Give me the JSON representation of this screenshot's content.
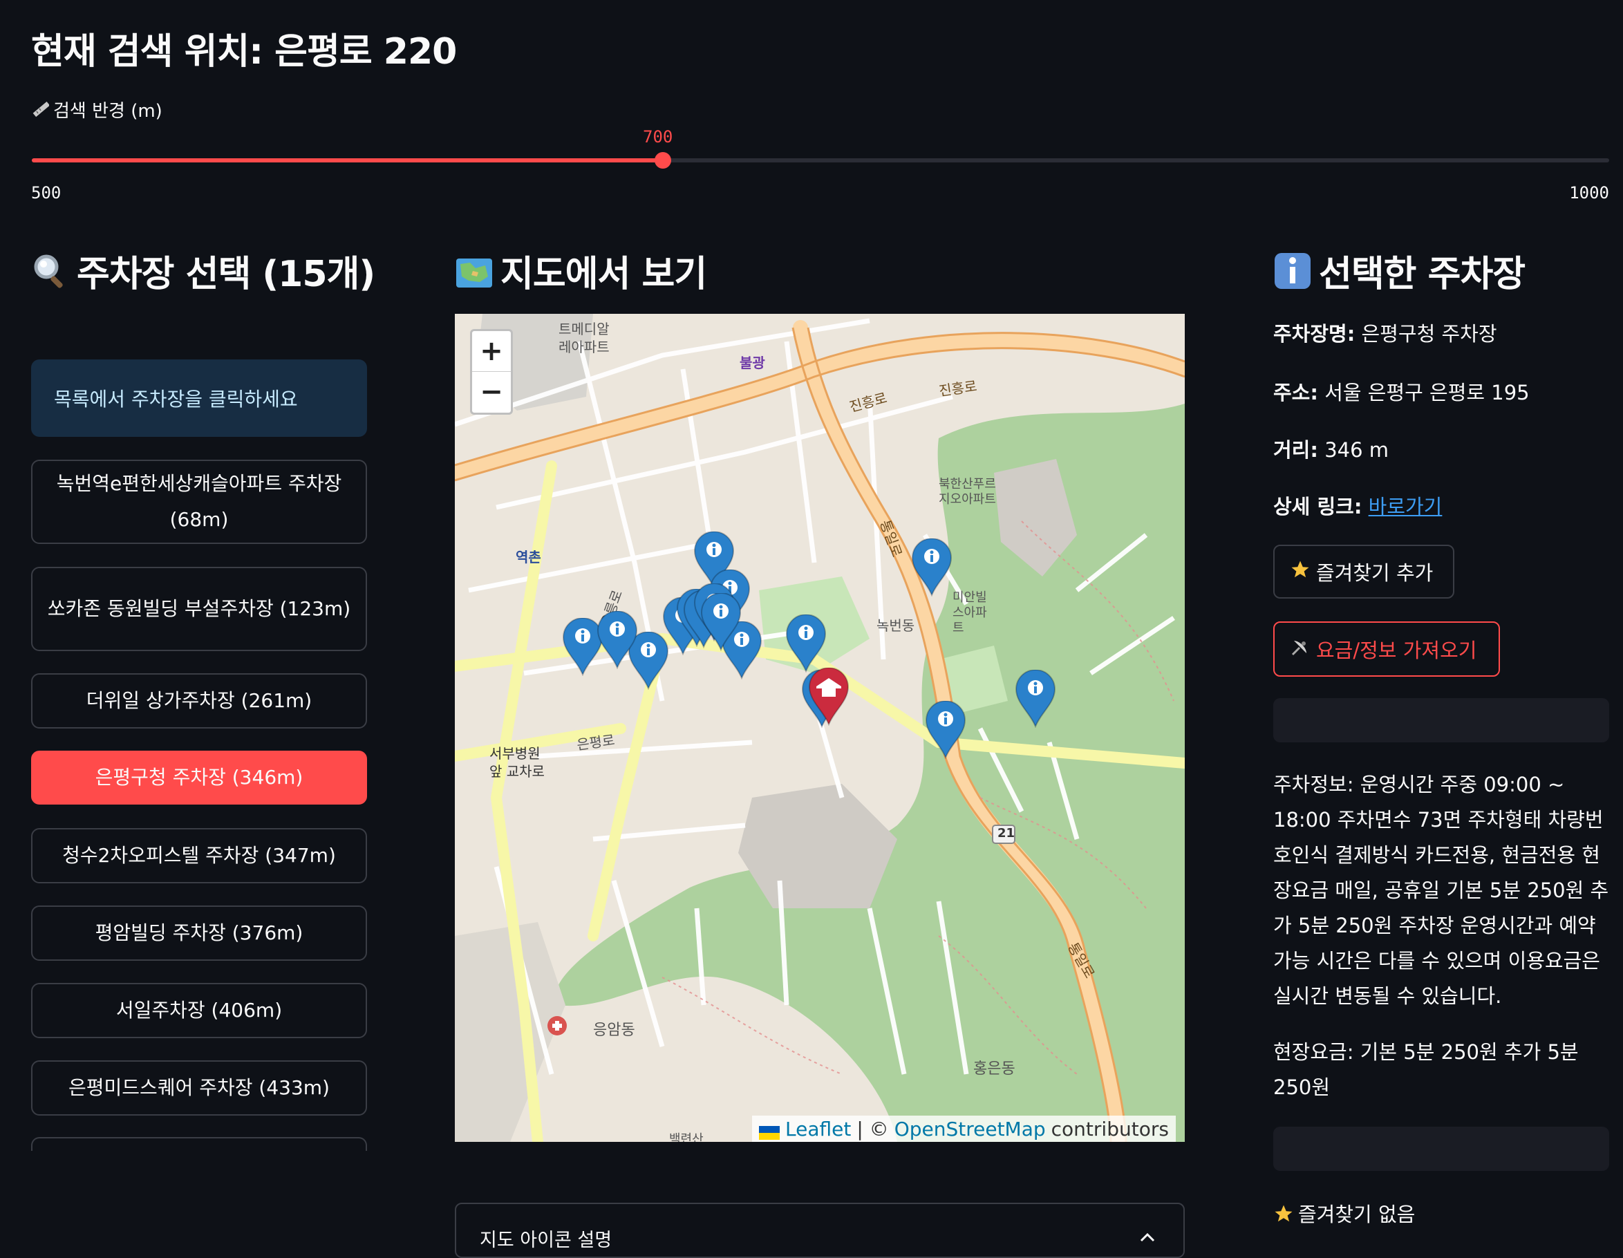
{
  "header": {
    "title": "현재 검색 위치: 은평로 220"
  },
  "radius": {
    "label": "검색 반경 (m)",
    "value": "700",
    "min": "500",
    "max": "1000",
    "value_fraction": 0.4
  },
  "left": {
    "title": "주차장 선택 (15개)",
    "info": "목록에서 주차장을 클릭하세요",
    "items": [
      {
        "label": "녹번역e편한세상캐슬아파트 주차장 (68m)"
      },
      {
        "label": "쏘카존 동원빌딩 부설주차장 (123m)"
      },
      {
        "label": "더위일 상가주차장 (261m)"
      },
      {
        "label": "은평구청 주차장 (346m)"
      },
      {
        "label": "청수2차오피스텔 주차장 (347m)"
      },
      {
        "label": "평암빌딩 주차장 (376m)"
      },
      {
        "label": "서일주차장 (406m)"
      },
      {
        "label": "은평미드스퀘어 주차장 (433m)"
      }
    ],
    "selected_index": 3
  },
  "map": {
    "title": "지도에서 보기",
    "zoom_in": "+",
    "zoom_out": "−",
    "attribution_leaflet": "Leaflet",
    "attribution_sep": "| ©",
    "attribution_osm": "OpenStreetMap",
    "attribution_tail": "contributors",
    "legend_title": "지도 아이콘 설명",
    "labels": {
      "l1": "트메디알",
      "l2": "레아파트",
      "l3": "불광",
      "l4": "진흥로",
      "l5": "진흥로",
      "l6": "역촌",
      "l7": "녹번동",
      "l8": "서부병원",
      "l9": "앞 교차로",
      "l10": "은평로",
      "l11": "응암동",
      "l12": "홍은동",
      "l13": "통일로",
      "l14": "통일로",
      "l15": "21",
      "l16": "서오릉로",
      "l17": "북한산푸르지오아파트",
      "l18": "미안빌스아파트",
      "l19": "백련산"
    }
  },
  "right": {
    "title": "선택한 주차장",
    "name_label": "주차장명:",
    "name": "은평구청 주차장",
    "addr_label": "주소:",
    "addr": "서울 은평구 은평로 195",
    "dist_label": "거리:",
    "dist": "346 m",
    "link_label": "상세 링크:",
    "link": "바로가기",
    "fav_add": "즐겨찾기 추가",
    "fetch": "요금/정보 가져오기",
    "desc": "주차정보: 운영시간 주중 09:00 ~ 18:00 주차면수 73면 주차형태 차량번호인식 결제방식 카드전용, 현금전용 현장요금 매일, 공휴일 기본 5분 250원 추가 5분 250원 주차장 운영시간과 예약 가능 시간은 다를 수 있으며 이용요금은 실시간 변동될 수 있습니다.",
    "fee": "현장요금: 기본 5분 250원 추가 5분 250원",
    "no_fav": "즐겨찾기 없음"
  },
  "colors": {
    "accent": "#ff4b4b",
    "background": "#0e1117",
    "info_bg": "#172d43",
    "link": "#3d9df3",
    "marker": "#2a81cb",
    "home_marker": "#cb2b3e"
  }
}
